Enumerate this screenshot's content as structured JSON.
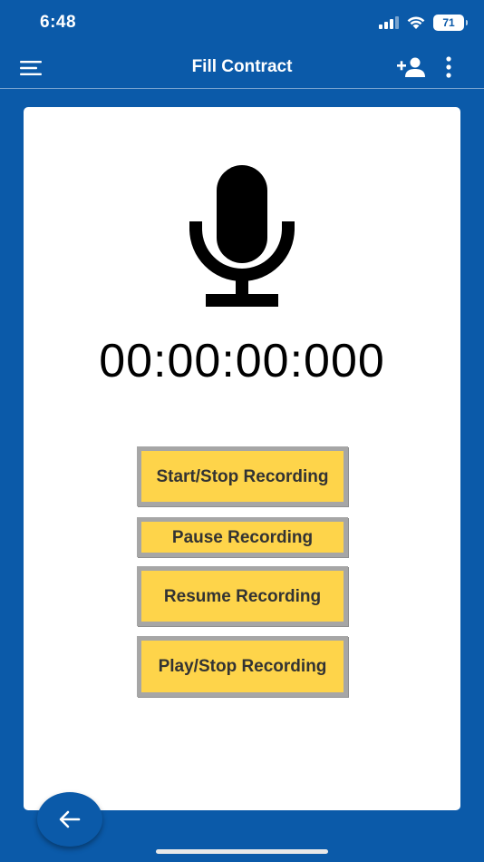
{
  "status_bar": {
    "time": "6:48",
    "battery_level": "71",
    "icons": [
      "signal-icon",
      "wifi-icon",
      "battery-icon"
    ]
  },
  "toolbar": {
    "title": "Fill Contract",
    "icons": [
      "menu-icon",
      "add-user-icon",
      "more-vertical-icon"
    ]
  },
  "recorder": {
    "icon": "microphone-icon",
    "timer": "00:00:00:000",
    "buttons": {
      "start_stop": "Start/Stop Recording",
      "pause": "Pause Recording",
      "resume": "Resume Recording",
      "play_stop": "Play/Stop Recording"
    }
  },
  "nav": {
    "back_icon": "arrow-left-icon"
  },
  "colors": {
    "primary": "#0b5aa9",
    "button_fill": "#fed44a",
    "button_border": "#a6a6a6",
    "card": "#ffffff"
  }
}
